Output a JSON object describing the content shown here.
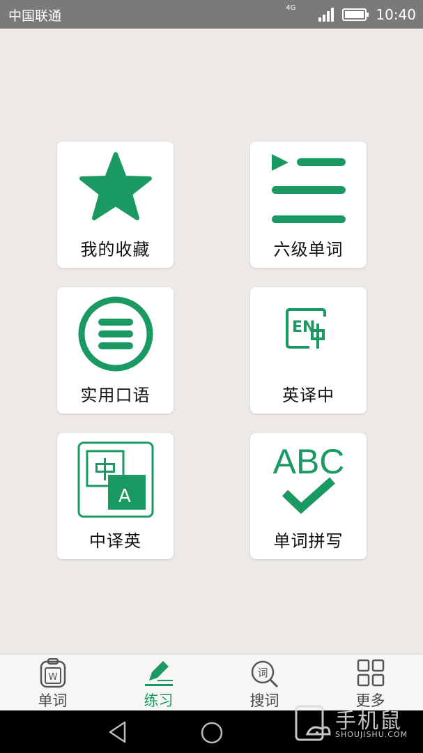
{
  "status_bar": {
    "carrier": "中国联通",
    "network": "4G",
    "time": "10:40"
  },
  "grid": {
    "items": [
      {
        "label": "我的收藏",
        "icon": "star-icon"
      },
      {
        "label": "六级单词",
        "icon": "playlist-icon"
      },
      {
        "label": "实用口语",
        "icon": "circle-menu-icon"
      },
      {
        "label": "英译中",
        "icon": "en-to-zh-icon"
      },
      {
        "label": "中译英",
        "icon": "zh-to-en-icon"
      },
      {
        "label": "单词拼写",
        "icon": "abc-check-icon"
      }
    ]
  },
  "tabs": [
    {
      "label": "单词",
      "icon": "word-book-icon",
      "active": false
    },
    {
      "label": "练习",
      "icon": "pencil-icon",
      "active": true
    },
    {
      "label": "搜词",
      "icon": "search-word-icon",
      "active": false
    },
    {
      "label": "更多",
      "icon": "grid-icon",
      "active": false
    }
  ],
  "watermark": {
    "title": "手机鼠",
    "subtitle": "SHOUJISHU.COM"
  },
  "colors": {
    "accent": "#1a9a62",
    "background": "#ece9e6",
    "status_bar": "#7a7a7a"
  }
}
